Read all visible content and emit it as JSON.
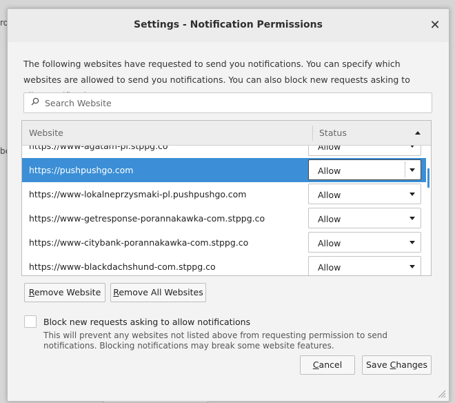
{
  "background": {
    "left_text_1": "ro",
    "left_text_2": "be"
  },
  "dialog": {
    "title": "Settings - Notification Permissions",
    "close_glyph": "✕",
    "description": "The following websites have requested to send you notifications. You can specify which websites are allowed to send you notifications. You can also block new requests asking to allow notifications.",
    "search": {
      "placeholder": "Search Website",
      "value": ""
    },
    "table": {
      "headers": {
        "website": "Website",
        "status": "Status"
      },
      "sort": "status-ascending",
      "rows": [
        {
          "site": "https://www-agatam-pl.stppg.co",
          "status": "Allow",
          "selected": false
        },
        {
          "site": "https://pushpushgo.com",
          "status": "Allow",
          "selected": true
        },
        {
          "site": "https://www-lokalneprzysmaki-pl.pushpushgo.com",
          "status": "Allow",
          "selected": false
        },
        {
          "site": "https://www-getresponse-porannakawka-com.stppg.co",
          "status": "Allow",
          "selected": false
        },
        {
          "site": "https://www-citybank-porannakawka-com.stppg.co",
          "status": "Allow",
          "selected": false
        },
        {
          "site": "https://www-blackdachshund-com.stppg.co",
          "status": "Allow",
          "selected": false
        }
      ]
    },
    "buttons": {
      "remove_website": {
        "mnemonic": "R",
        "rest": "emove Website"
      },
      "remove_all": {
        "mnemonic": "R",
        "rest": "emove All Websites"
      },
      "cancel": {
        "mnemonic": "C",
        "rest": "ancel"
      },
      "save": {
        "before": "Save ",
        "mnemonic": "C",
        "rest": "hanges"
      }
    },
    "block": {
      "checked": false,
      "label": "Block new requests asking to allow notifications",
      "hint": "This will prevent any websites not listed above from requesting permission to send notifications. Blocking notifications may break some website features."
    },
    "colors": {
      "selection": "#3c8fd6",
      "dialog_bg": "#f3f3f3"
    }
  }
}
